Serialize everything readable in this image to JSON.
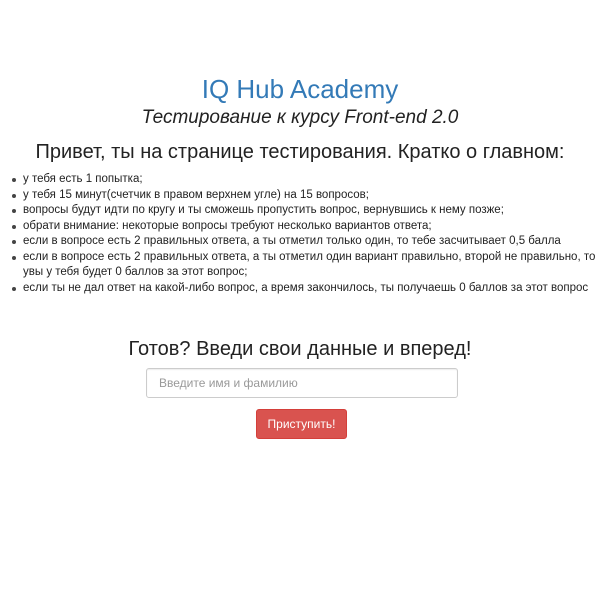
{
  "header": {
    "brand": "IQ Hub Academy",
    "course": "Тестирование к курсу Front-end 2.0",
    "greeting": "Привет, ты на странице тестирования. Кратко о главном:"
  },
  "rules": [
    "у тебя есть 1 попытка;",
    "у тебя 15 минут(счетчик в правом верхнем угле) на 15 вопросов;",
    "вопросы будут идти по кругу и ты сможешь пропустить вопрос, вернувшись к нему позже;",
    "обрати внимание: некоторые вопросы требуют несколько вариантов ответа;",
    "если в вопросе есть 2 правильных ответа, а ты отметил только один, то тебе засчитывает 0,5 балла",
    "если в вопросе есть 2 правильных ответа, а ты отметил один вариант правильно, второй не правильно, то увы у тебя будет 0 баллов за этот вопрос;",
    "если ты не дал ответ на какой-либо вопрос, а время закончилось, ты получаешь 0 баллов за этот вопрос"
  ],
  "form": {
    "title": "Готов? Введи свои данные и вперед!",
    "name_placeholder": "Введите имя и фамилию",
    "name_value": "",
    "start_label": "Приступить!"
  },
  "colors": {
    "brand": "#337ab7",
    "button": "#d9534f"
  }
}
